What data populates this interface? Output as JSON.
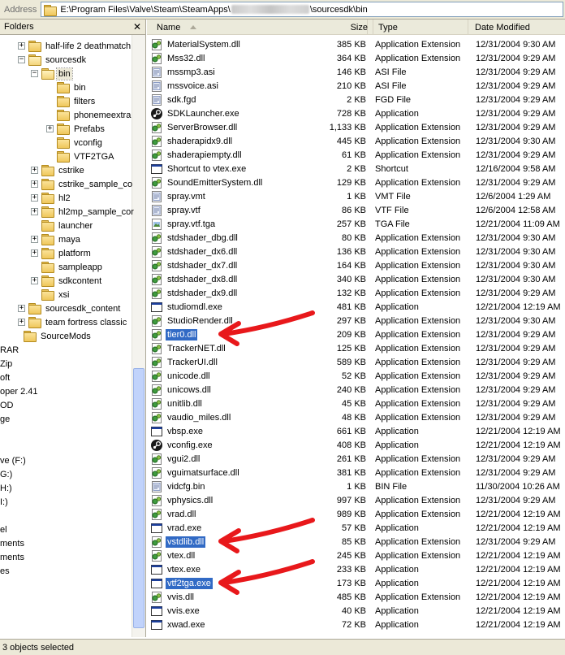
{
  "address": {
    "label": "Address",
    "path_prefix": "E:\\Program Files\\Valve\\Steam\\SteamApps\\",
    "path_suffix": "\\sourcesdk\\bin"
  },
  "folders_pane": {
    "title": "Folders",
    "close_glyph": "✕",
    "items": [
      {
        "label": "half-life 2 deathmatch",
        "indent": 1,
        "expander": "+"
      },
      {
        "label": "sourcesdk",
        "indent": 1,
        "expander": "−",
        "open": true
      },
      {
        "label": "bin",
        "indent": 2,
        "expander": "−",
        "open": true,
        "selected": true
      },
      {
        "label": "bin",
        "indent": 3,
        "expander": ""
      },
      {
        "label": "filters",
        "indent": 3,
        "expander": ""
      },
      {
        "label": "phonemeextra",
        "indent": 3,
        "expander": ""
      },
      {
        "label": "Prefabs",
        "indent": 3,
        "expander": "+"
      },
      {
        "label": "vconfig",
        "indent": 3,
        "expander": ""
      },
      {
        "label": "VTF2TGA",
        "indent": 3,
        "expander": ""
      },
      {
        "label": "cstrike",
        "indent": 2,
        "expander": "+"
      },
      {
        "label": "cstrike_sample_co",
        "indent": 2,
        "expander": "+"
      },
      {
        "label": "hl2",
        "indent": 2,
        "expander": "+"
      },
      {
        "label": "hl2mp_sample_cor",
        "indent": 2,
        "expander": "+"
      },
      {
        "label": "launcher",
        "indent": 2,
        "expander": ""
      },
      {
        "label": "maya",
        "indent": 2,
        "expander": "+"
      },
      {
        "label": "platform",
        "indent": 2,
        "expander": "+"
      },
      {
        "label": "sampleapp",
        "indent": 2,
        "expander": ""
      },
      {
        "label": "sdkcontent",
        "indent": 2,
        "expander": "+"
      },
      {
        "label": "xsi",
        "indent": 2,
        "expander": ""
      },
      {
        "label": "sourcesdk_content",
        "indent": 1,
        "expander": "+"
      },
      {
        "label": "team fortress classic",
        "indent": 1,
        "expander": "+"
      },
      {
        "label": "SourceMods",
        "indent": 0,
        "expander": ""
      }
    ],
    "clipped_items": [
      "RAR",
      "Zip",
      "oft",
      "oper 2.41",
      "OD",
      "ge",
      "",
      "",
      "ve (F:)",
      "G:)",
      "H:)",
      "I:)",
      "",
      "el",
      "ments",
      "ments",
      "es"
    ]
  },
  "file_list": {
    "columns": {
      "name": "Name",
      "size": "Size",
      "type": "Type",
      "date": "Date Modified"
    },
    "rows": [
      {
        "name": "MaterialSystem.dll",
        "size": "385 KB",
        "type": "Application Extension",
        "date": "12/31/2004 9:30 AM",
        "icon": "dll"
      },
      {
        "name": "Mss32.dll",
        "size": "364 KB",
        "type": "Application Extension",
        "date": "12/31/2004 9:29 AM",
        "icon": "dll"
      },
      {
        "name": "mssmp3.asi",
        "size": "146 KB",
        "type": "ASI File",
        "date": "12/31/2004 9:29 AM",
        "icon": "doc"
      },
      {
        "name": "mssvoice.asi",
        "size": "210 KB",
        "type": "ASI File",
        "date": "12/31/2004 9:29 AM",
        "icon": "doc"
      },
      {
        "name": "sdk.fgd",
        "size": "2 KB",
        "type": "FGD File",
        "date": "12/31/2004 9:29 AM",
        "icon": "doc"
      },
      {
        "name": "SDKLauncher.exe",
        "size": "728 KB",
        "type": "Application",
        "date": "12/31/2004 9:29 AM",
        "icon": "steam"
      },
      {
        "name": "ServerBrowser.dll",
        "size": "1,133 KB",
        "type": "Application Extension",
        "date": "12/31/2004 9:29 AM",
        "icon": "dll"
      },
      {
        "name": "shaderapidx9.dll",
        "size": "445 KB",
        "type": "Application Extension",
        "date": "12/31/2004 9:30 AM",
        "icon": "dll"
      },
      {
        "name": "shaderapiempty.dll",
        "size": "61 KB",
        "type": "Application Extension",
        "date": "12/31/2004 9:29 AM",
        "icon": "dll"
      },
      {
        "name": "Shortcut to vtex.exe",
        "size": "2 KB",
        "type": "Shortcut",
        "date": "12/16/2004 9:58 AM",
        "icon": "exe"
      },
      {
        "name": "SoundEmitterSystem.dll",
        "size": "129 KB",
        "type": "Application Extension",
        "date": "12/31/2004 9:29 AM",
        "icon": "dll"
      },
      {
        "name": "spray.vmt",
        "size": "1 KB",
        "type": "VMT File",
        "date": "12/6/2004 1:29 AM",
        "icon": "doc"
      },
      {
        "name": "spray.vtf",
        "size": "86 KB",
        "type": "VTF File",
        "date": "12/6/2004 12:58 AM",
        "icon": "doc"
      },
      {
        "name": "spray.vtf.tga",
        "size": "257 KB",
        "type": "TGA File",
        "date": "12/21/2004 11:09 AM",
        "icon": "img"
      },
      {
        "name": "stdshader_dbg.dll",
        "size": "80 KB",
        "type": "Application Extension",
        "date": "12/31/2004 9:30 AM",
        "icon": "dll"
      },
      {
        "name": "stdshader_dx6.dll",
        "size": "136 KB",
        "type": "Application Extension",
        "date": "12/31/2004 9:30 AM",
        "icon": "dll"
      },
      {
        "name": "stdshader_dx7.dll",
        "size": "164 KB",
        "type": "Application Extension",
        "date": "12/31/2004 9:30 AM",
        "icon": "dll"
      },
      {
        "name": "stdshader_dx8.dll",
        "size": "340 KB",
        "type": "Application Extension",
        "date": "12/31/2004 9:30 AM",
        "icon": "dll"
      },
      {
        "name": "stdshader_dx9.dll",
        "size": "132 KB",
        "type": "Application Extension",
        "date": "12/31/2004 9:29 AM",
        "icon": "dll"
      },
      {
        "name": "studiomdl.exe",
        "size": "481 KB",
        "type": "Application",
        "date": "12/21/2004 12:19 AM",
        "icon": "exe"
      },
      {
        "name": "StudioRender.dll",
        "size": "297 KB",
        "type": "Application Extension",
        "date": "12/31/2004 9:30 AM",
        "icon": "dll"
      },
      {
        "name": "tier0.dll",
        "size": "209 KB",
        "type": "Application Extension",
        "date": "12/31/2004 9:29 AM",
        "icon": "dll",
        "selected": true
      },
      {
        "name": "TrackerNET.dll",
        "size": "125 KB",
        "type": "Application Extension",
        "date": "12/31/2004 9:29 AM",
        "icon": "dll"
      },
      {
        "name": "TrackerUI.dll",
        "size": "589 KB",
        "type": "Application Extension",
        "date": "12/31/2004 9:29 AM",
        "icon": "dll"
      },
      {
        "name": "unicode.dll",
        "size": "52 KB",
        "type": "Application Extension",
        "date": "12/31/2004 9:29 AM",
        "icon": "dll"
      },
      {
        "name": "unicows.dll",
        "size": "240 KB",
        "type": "Application Extension",
        "date": "12/31/2004 9:29 AM",
        "icon": "dll"
      },
      {
        "name": "unitlib.dll",
        "size": "45 KB",
        "type": "Application Extension",
        "date": "12/31/2004 9:29 AM",
        "icon": "dll"
      },
      {
        "name": "vaudio_miles.dll",
        "size": "48 KB",
        "type": "Application Extension",
        "date": "12/31/2004 9:29 AM",
        "icon": "dll"
      },
      {
        "name": "vbsp.exe",
        "size": "661 KB",
        "type": "Application",
        "date": "12/21/2004 12:19 AM",
        "icon": "exe"
      },
      {
        "name": "vconfig.exe",
        "size": "408 KB",
        "type": "Application",
        "date": "12/21/2004 12:19 AM",
        "icon": "steam"
      },
      {
        "name": "vgui2.dll",
        "size": "261 KB",
        "type": "Application Extension",
        "date": "12/31/2004 9:29 AM",
        "icon": "dll"
      },
      {
        "name": "vguimatsurface.dll",
        "size": "381 KB",
        "type": "Application Extension",
        "date": "12/31/2004 9:29 AM",
        "icon": "dll"
      },
      {
        "name": "vidcfg.bin",
        "size": "1 KB",
        "type": "BIN File",
        "date": "11/30/2004 10:26 AM",
        "icon": "doc"
      },
      {
        "name": "vphysics.dll",
        "size": "997 KB",
        "type": "Application Extension",
        "date": "12/31/2004 9:29 AM",
        "icon": "dll"
      },
      {
        "name": "vrad.dll",
        "size": "989 KB",
        "type": "Application Extension",
        "date": "12/21/2004 12:19 AM",
        "icon": "dll"
      },
      {
        "name": "vrad.exe",
        "size": "57 KB",
        "type": "Application",
        "date": "12/21/2004 12:19 AM",
        "icon": "exe"
      },
      {
        "name": "vstdlib.dll",
        "size": "85 KB",
        "type": "Application Extension",
        "date": "12/31/2004 9:29 AM",
        "icon": "dll",
        "selected": true
      },
      {
        "name": "vtex.dll",
        "size": "245 KB",
        "type": "Application Extension",
        "date": "12/21/2004 12:19 AM",
        "icon": "dll"
      },
      {
        "name": "vtex.exe",
        "size": "233 KB",
        "type": "Application",
        "date": "12/21/2004 12:19 AM",
        "icon": "exe"
      },
      {
        "name": "vtf2tga.exe",
        "size": "173 KB",
        "type": "Application",
        "date": "12/21/2004 12:19 AM",
        "icon": "exe",
        "selected": true
      },
      {
        "name": "vvis.dll",
        "size": "485 KB",
        "type": "Application Extension",
        "date": "12/21/2004 12:19 AM",
        "icon": "dll"
      },
      {
        "name": "vvis.exe",
        "size": "40 KB",
        "type": "Application",
        "date": "12/21/2004 12:19 AM",
        "icon": "exe"
      },
      {
        "name": "xwad.exe",
        "size": "72 KB",
        "type": "Application",
        "date": "12/21/2004 12:19 AM",
        "icon": "exe"
      }
    ]
  },
  "status": {
    "text": "3 objects selected"
  },
  "colors": {
    "selection": "#316ac5",
    "annotation_arrow": "#e8181b",
    "chrome": "#ece9d8"
  }
}
